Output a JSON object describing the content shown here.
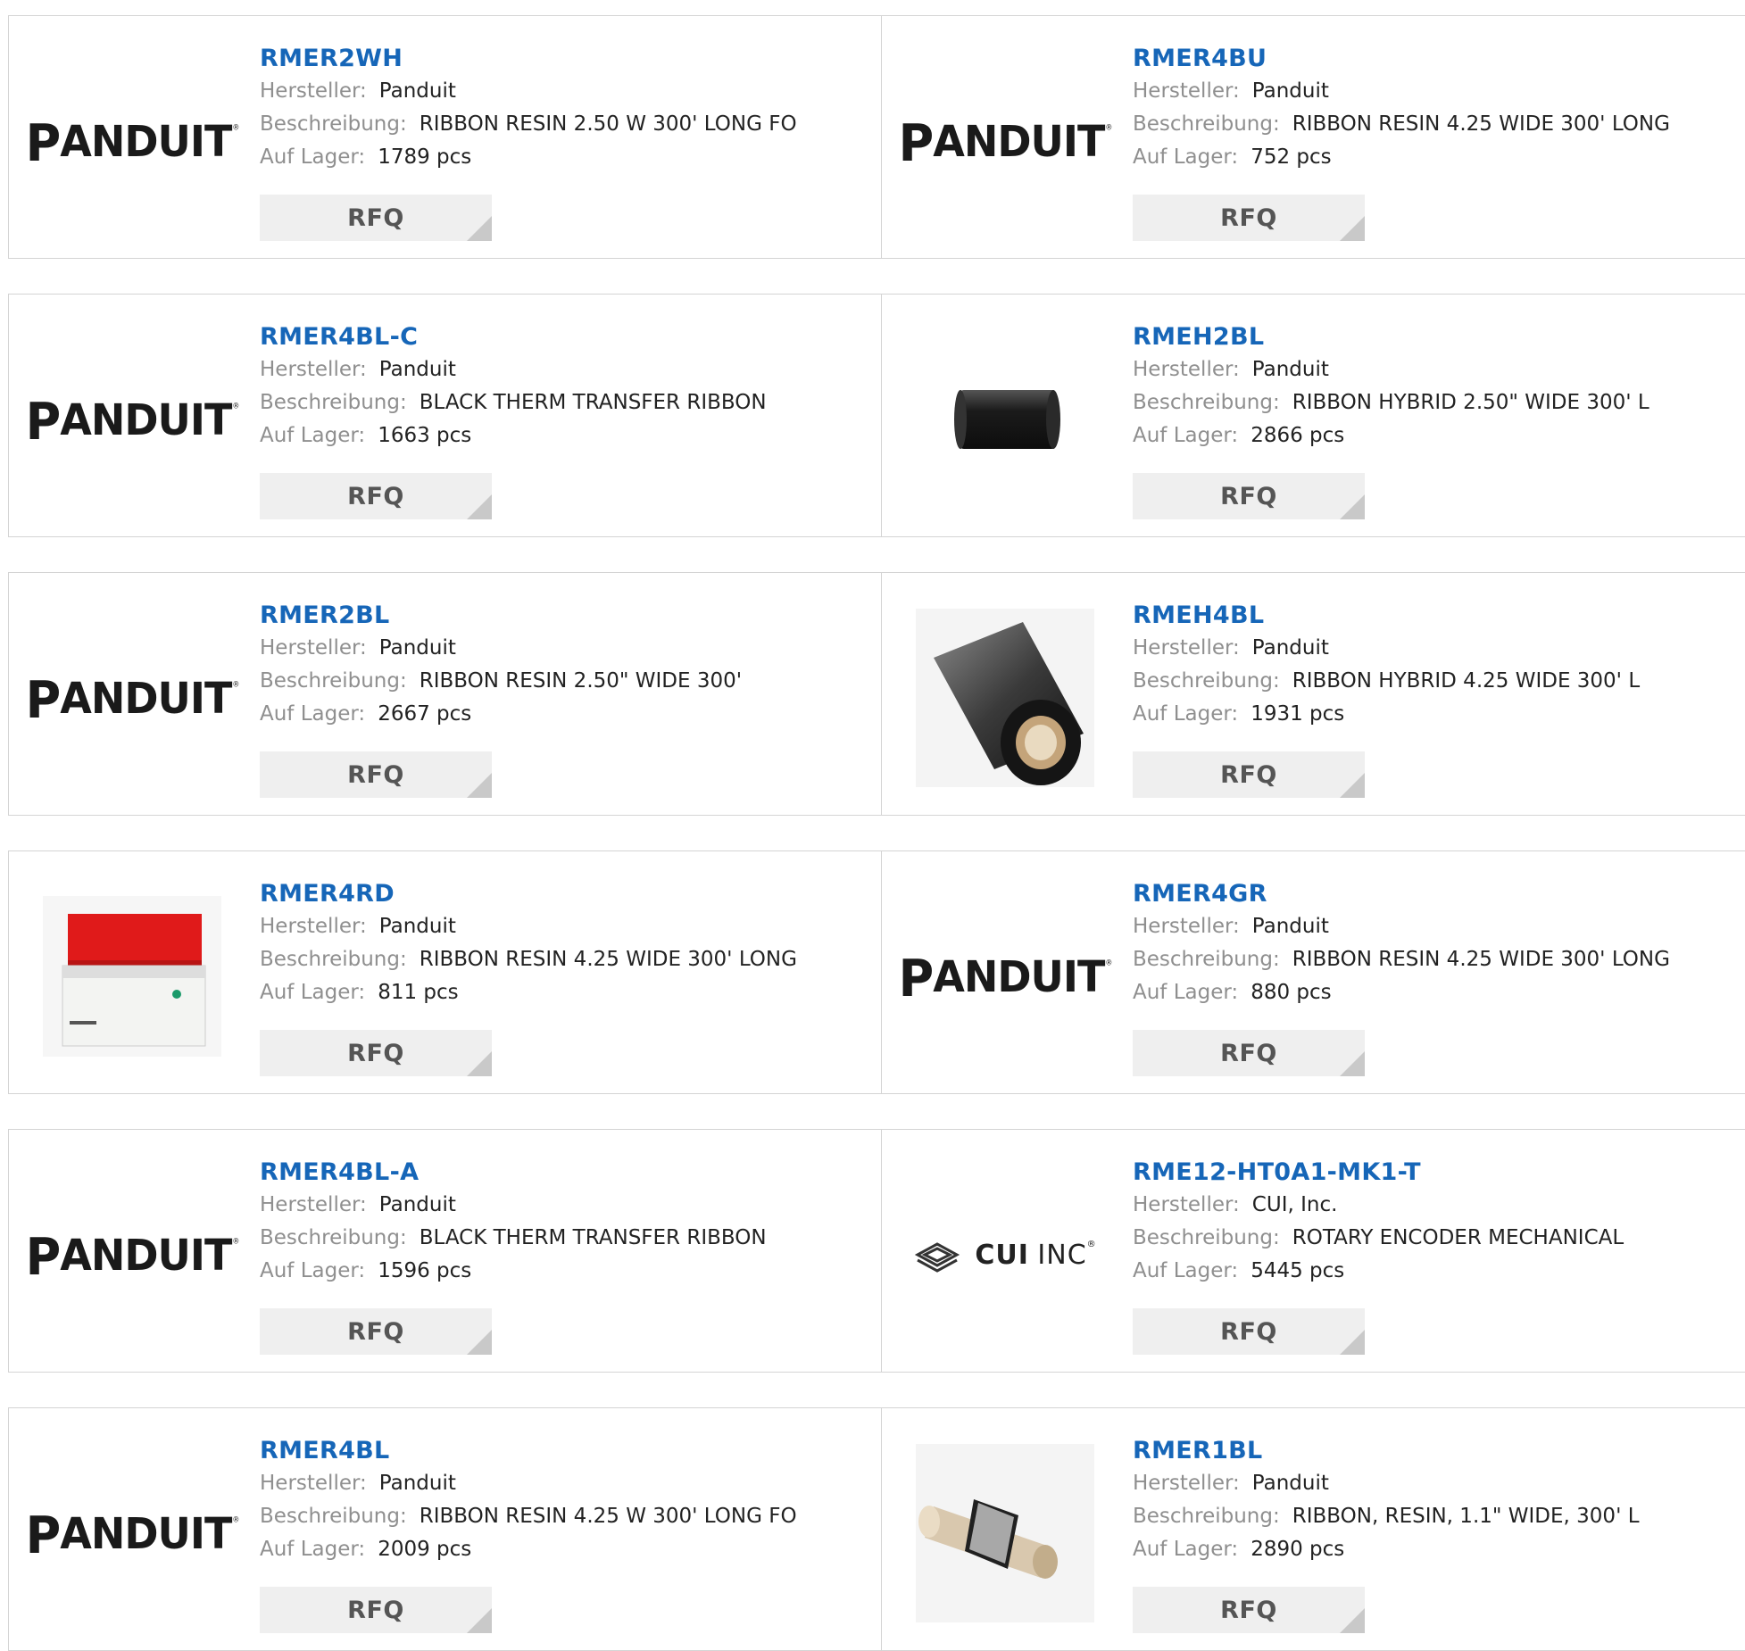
{
  "labels": {
    "manufacturer": "Hersteller:",
    "description": "Beschreibung:",
    "stock": "Auf Lager:",
    "rfq": "RFQ"
  },
  "logos": {
    "panduit": "PANDUIT",
    "cui_brand": "CUI",
    "cui_suffix": "INC"
  },
  "products": [
    {
      "part": "RMER2WH",
      "manufacturer": "Panduit",
      "description": "RIBBON RESIN 2.50 W 300' LONG FO",
      "stock": "1789 pcs",
      "image": "panduit-logo"
    },
    {
      "part": "RMER4BU",
      "manufacturer": "Panduit",
      "description": "RIBBON RESIN 4.25 WIDE 300' LONG",
      "stock": "752 pcs",
      "image": "panduit-logo"
    },
    {
      "part": "RMER4BL-C",
      "manufacturer": "Panduit",
      "description": "BLACK THERM TRANSFER RIBBON",
      "stock": "1663 pcs",
      "image": "panduit-logo"
    },
    {
      "part": "RMEH2BL",
      "manufacturer": "Panduit",
      "description": "RIBBON HYBRID 2.50\" WIDE 300' L",
      "stock": "2866 pcs",
      "image": "black-ribbon-roll-small"
    },
    {
      "part": "RMER2BL",
      "manufacturer": "Panduit",
      "description": "RIBBON RESIN 2.50\" WIDE 300'",
      "stock": "2667 pcs",
      "image": "panduit-logo"
    },
    {
      "part": "RMEH4BL",
      "manufacturer": "Panduit",
      "description": "RIBBON HYBRID 4.25 WIDE 300' L",
      "stock": "1931 pcs",
      "image": "black-ribbon-roll-large"
    },
    {
      "part": "RMER4RD",
      "manufacturer": "Panduit",
      "description": "RIBBON RESIN 4.25 WIDE 300' LONG",
      "stock": "811 pcs",
      "image": "red-ribbon-box"
    },
    {
      "part": "RMER4GR",
      "manufacturer": "Panduit",
      "description": "RIBBON RESIN 4.25 WIDE 300' LONG",
      "stock": "880 pcs",
      "image": "panduit-logo"
    },
    {
      "part": "RMER4BL-A",
      "manufacturer": "Panduit",
      "description": "BLACK THERM TRANSFER RIBBON",
      "stock": "1596 pcs",
      "image": "panduit-logo"
    },
    {
      "part": "RME12-HT0A1-MK1-T",
      "manufacturer": "CUI, Inc.",
      "description": "ROTARY ENCODER MECHANICAL",
      "stock": "5445 pcs",
      "image": "cui-logo"
    },
    {
      "part": "RMER4BL",
      "manufacturer": "Panduit",
      "description": "RIBBON RESIN 4.25 W 300' LONG FO",
      "stock": "2009 pcs",
      "image": "panduit-logo"
    },
    {
      "part": "RMER1BL",
      "manufacturer": "Panduit",
      "description": "RIBBON, RESIN, 1.1\" WIDE, 300' L",
      "stock": "2890 pcs",
      "image": "silver-ribbon-roll-small"
    }
  ],
  "colors": {
    "link": "#1666b8",
    "label": "#8f8f8f",
    "border": "#d4d4d4",
    "button_bg": "#efefef"
  }
}
